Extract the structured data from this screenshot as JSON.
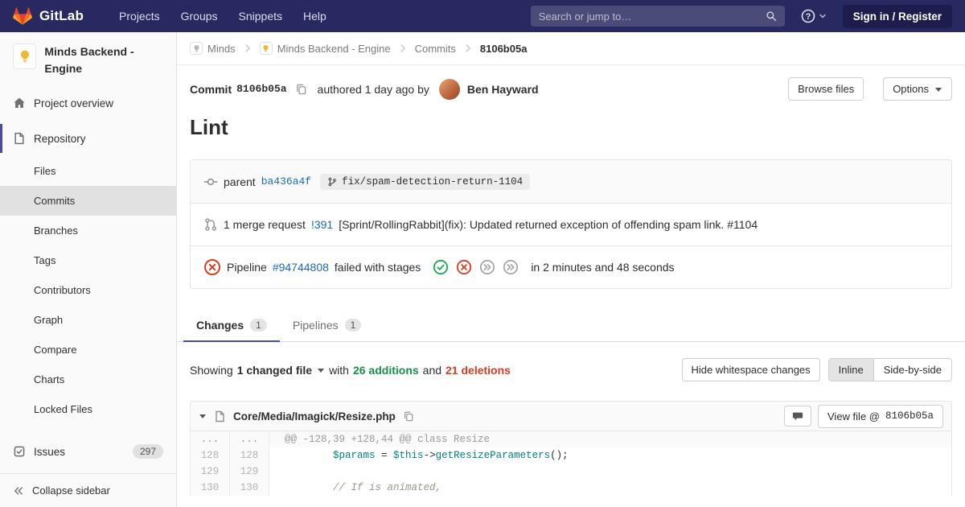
{
  "colors": {
    "navbar_bg": "#292961",
    "link_blue": "#1b69b6",
    "additions_green": "#168f48",
    "deletions_red": "#db3b21",
    "pipeline_success": "#1aaa55",
    "pipeline_failed": "#db3b21",
    "pipeline_skipped": "#a8a8a8",
    "tab_indicator": "#4b4ba3"
  },
  "navbar": {
    "brand": "GitLab",
    "menu": [
      "Projects",
      "Groups",
      "Snippets",
      "Help"
    ],
    "search_placeholder": "Search or jump to…",
    "sign_in_label": "Sign in / Register"
  },
  "sidebar": {
    "project_name": "Minds Backend - Engine",
    "nav": [
      {
        "label": "Project overview",
        "icon": "home",
        "level": "top"
      },
      {
        "label": "Repository",
        "icon": "repository",
        "level": "top",
        "active_section": true
      },
      {
        "label": "Files",
        "level": "sub"
      },
      {
        "label": "Commits",
        "level": "sub",
        "active": true
      },
      {
        "label": "Branches",
        "level": "sub"
      },
      {
        "label": "Tags",
        "level": "sub"
      },
      {
        "label": "Contributors",
        "level": "sub"
      },
      {
        "label": "Graph",
        "level": "sub"
      },
      {
        "label": "Compare",
        "level": "sub"
      },
      {
        "label": "Charts",
        "level": "sub"
      },
      {
        "label": "Locked Files",
        "level": "sub"
      },
      {
        "label": "Issues",
        "icon": "issues",
        "level": "top",
        "badge": "297",
        "section_gap": true
      }
    ],
    "collapse_label": "Collapse sidebar"
  },
  "breadcrumb": {
    "items": [
      {
        "label": "Minds",
        "avatar": "group"
      },
      {
        "label": "Minds Backend - Engine",
        "avatar": "project"
      },
      {
        "label": "Commits"
      },
      {
        "label": "8106b05a",
        "current": true
      }
    ]
  },
  "commit": {
    "label": "Commit",
    "sha": "8106b05a",
    "authored_text": "authored 1 day ago by",
    "author_name": "Ben Hayward",
    "browse_files_label": "Browse files",
    "options_label": "Options",
    "title": "Lint",
    "parent_label": "parent",
    "parent_sha": "ba436a4f",
    "branch_ref": "fix/spam-detection-return-1104",
    "merge_request": {
      "prefix": "1 merge request",
      "link": "!391",
      "text": "[Sprint/RollingRabbit](fix): Updated returned exception of offending spam link. #1104"
    },
    "pipeline": {
      "prefix": "Pipeline",
      "id": "#94744808",
      "status_text": "failed with stages",
      "stages": [
        "success",
        "failed",
        "skipped",
        "skipped"
      ],
      "duration_text": "in 2 minutes and 48 seconds"
    }
  },
  "tabs": [
    {
      "label": "Changes",
      "count": "1",
      "active": true
    },
    {
      "label": "Pipelines",
      "count": "1"
    }
  ],
  "diff_controls": {
    "showing": "Showing",
    "changed_files": "1 changed file",
    "with": "with",
    "additions": "26 additions",
    "and": "and",
    "deletions": "21 deletions",
    "hide_whitespace": "Hide whitespace changes",
    "view_options": [
      "Inline",
      "Side-by-side"
    ],
    "active_view": "Inline"
  },
  "file": {
    "path": "Core/Media/Imagick/Resize.php",
    "view_file_label": "View file @",
    "view_file_sha": "8106b05a"
  },
  "diff": {
    "lines": [
      {
        "old": "...",
        "new": "...",
        "kind": "hunk",
        "tokens": [
          {
            "t": "@@ -128,39 +128,44 @@ class Resize",
            "c": "hunk"
          }
        ]
      },
      {
        "old": "128",
        "new": "128",
        "kind": "context",
        "tokens": [
          {
            "t": "        "
          },
          {
            "t": "$params",
            "c": "var"
          },
          {
            "t": " = "
          },
          {
            "t": "$this",
            "c": "var"
          },
          {
            "t": "->"
          },
          {
            "t": "getResizeParameters",
            "c": "fn"
          },
          {
            "t": "();"
          }
        ]
      },
      {
        "old": "129",
        "new": "129",
        "kind": "context",
        "tokens": []
      },
      {
        "old": "130",
        "new": "130",
        "kind": "context",
        "tokens": [
          {
            "t": "        "
          },
          {
            "t": "// If is animated,",
            "c": "comment"
          }
        ]
      }
    ]
  }
}
